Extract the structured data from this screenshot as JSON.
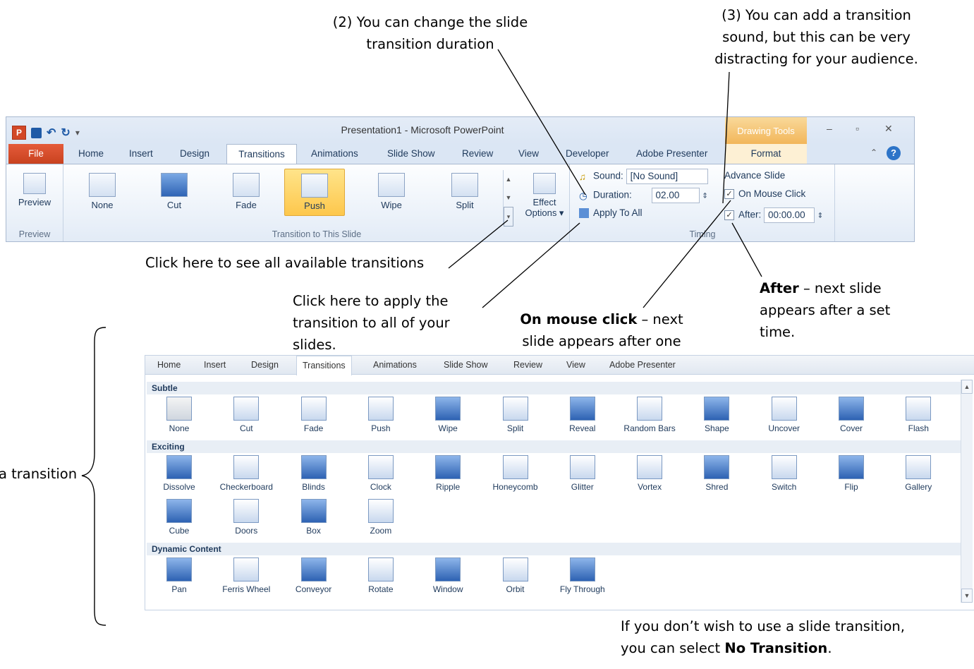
{
  "callouts": {
    "duration": [
      "(2) You can change the slide",
      "transition duration"
    ],
    "sound": [
      "(3) You can add a transition",
      "sound, but this can be very",
      "distracting for your audience."
    ],
    "gallery": "Click here to see all available transitions",
    "apply_all": [
      "Click here to apply the",
      "transition to all of your",
      "slides."
    ],
    "mouse_click": {
      "bold": "On mouse click",
      "rest1": " – next",
      "line2": "slide appears after one"
    },
    "after": {
      "bold": "After",
      "rest1": " – next slide",
      "line2": "appears after a set",
      "line3": "time."
    },
    "left_partial": "a transition",
    "no_transition": {
      "line1": "If you don’t wish to use a slide transition,",
      "prefix": "you can select ",
      "bold": "No Transition",
      "suffix": "."
    }
  },
  "window": {
    "title": "Presentation1  -  Microsoft PowerPoint",
    "app_icon": "P",
    "contextual_tab": "Drawing Tools",
    "tabs": [
      "File",
      "Home",
      "Insert",
      "Design",
      "Transitions",
      "Animations",
      "Slide Show",
      "Review",
      "View",
      "Developer",
      "Adobe Presenter",
      "Format"
    ],
    "active_tab": "Transitions",
    "minimize": "–",
    "maximize": "▫",
    "close": "✕",
    "help": "?"
  },
  "ribbon": {
    "preview_label": "Preview",
    "preview_group": "Preview",
    "transitions": [
      "None",
      "Cut",
      "Fade",
      "Push",
      "Wipe",
      "Split"
    ],
    "selected_transition": "Push",
    "effect_options": [
      "Effect",
      "Options ▾"
    ],
    "transition_group": "Transition to This Slide",
    "sound_label": "Sound:",
    "sound_value": "[No Sound]",
    "duration_label": "Duration:",
    "duration_value": "02.00",
    "apply_all": "Apply To All",
    "advance_slide": "Advance Slide",
    "on_mouse_click": "On Mouse Click",
    "after_label": "After:",
    "after_value": "00:00.00",
    "timing_group": "Timing"
  },
  "panel": {
    "tabs": [
      "Home",
      "Insert",
      "Design",
      "Transitions",
      "Animations",
      "Slide Show",
      "Review",
      "View",
      "Adobe Presenter"
    ],
    "active_tab": "Transitions",
    "sections": [
      {
        "title": "Subtle",
        "rows": [
          [
            "None",
            "Cut",
            "Fade",
            "Push",
            "Wipe",
            "Split",
            "Reveal",
            "Random Bars",
            "Shape",
            "Uncover",
            "Cover",
            "Flash"
          ]
        ]
      },
      {
        "title": "Exciting",
        "rows": [
          [
            "Dissolve",
            "Checkerboard",
            "Blinds",
            "Clock",
            "Ripple",
            "Honeycomb",
            "Glitter",
            "Vortex",
            "Shred",
            "Switch",
            "Flip",
            "Gallery"
          ],
          [
            "Cube",
            "Doors",
            "Box",
            "Zoom"
          ]
        ]
      },
      {
        "title": "Dynamic Content",
        "rows": [
          [
            "Pan",
            "Ferris Wheel",
            "Conveyor",
            "Rotate",
            "Window",
            "Orbit",
            "Fly Through"
          ]
        ]
      }
    ]
  }
}
